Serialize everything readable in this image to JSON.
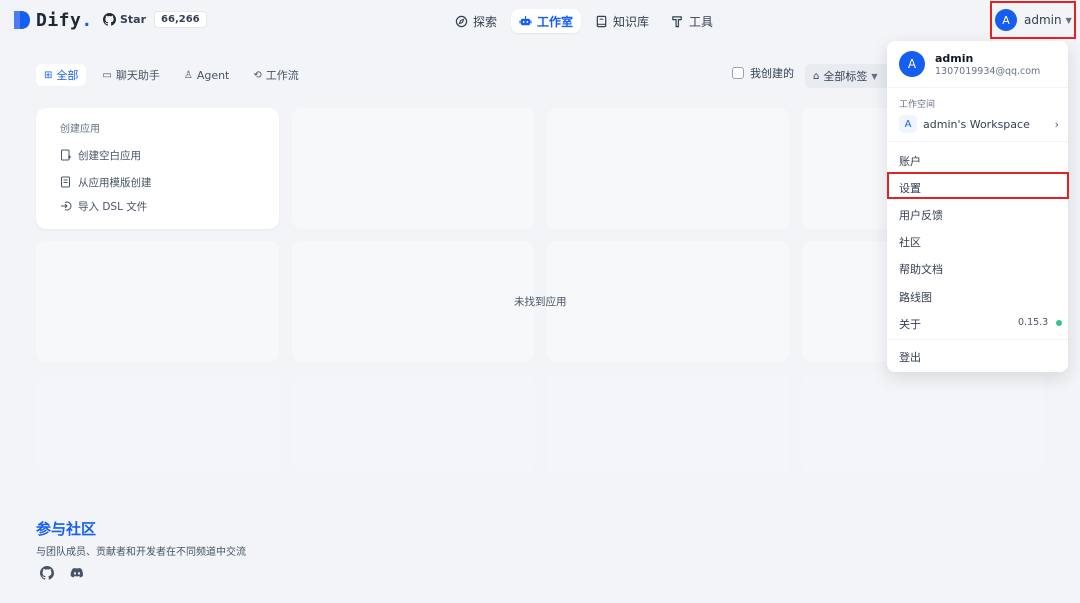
{
  "app": {
    "logo_text": "Dify",
    "logo_dot": ".",
    "star_label": "Star",
    "star_count": "66,266"
  },
  "nav": [
    {
      "label": "探索",
      "icon": "compass-icon"
    },
    {
      "label": "工作室",
      "icon": "robot-icon",
      "active": true
    },
    {
      "label": "知识库",
      "icon": "book-icon"
    },
    {
      "label": "工具",
      "icon": "hammer-icon"
    }
  ],
  "user": {
    "initial": "A",
    "name": "admin",
    "email": "1307019934@qq.com"
  },
  "tabs": [
    {
      "label": "全部",
      "icon": "grid-icon",
      "active": true
    },
    {
      "label": "聊天助手",
      "icon": "chat-icon"
    },
    {
      "label": "Agent",
      "icon": "agent-icon"
    },
    {
      "label": "工作流",
      "icon": "workflow-icon"
    }
  ],
  "filter": {
    "mine_label": "我创建的",
    "tags_label": "全部标签"
  },
  "create": {
    "title": "创建应用",
    "items": [
      "创建空白应用",
      "从应用模版创建",
      "导入 DSL 文件"
    ]
  },
  "empty_message": "未找到应用",
  "community": {
    "title": "参与社区",
    "subtitle": "与团队成员、贡献者和开发者在不同频道中交流"
  },
  "menu": {
    "workspace_label": "工作空间",
    "workspace_initial": "A",
    "workspace_name": "admin's Workspace",
    "items": [
      "账户",
      "设置",
      "用户反馈",
      "社区",
      "帮助文档",
      "路线图",
      "关于"
    ],
    "version": "0.15.3",
    "logout": "登出"
  },
  "colors": {
    "accent": "#155eef",
    "highlight": "#e02424",
    "status": "#31c48d"
  }
}
